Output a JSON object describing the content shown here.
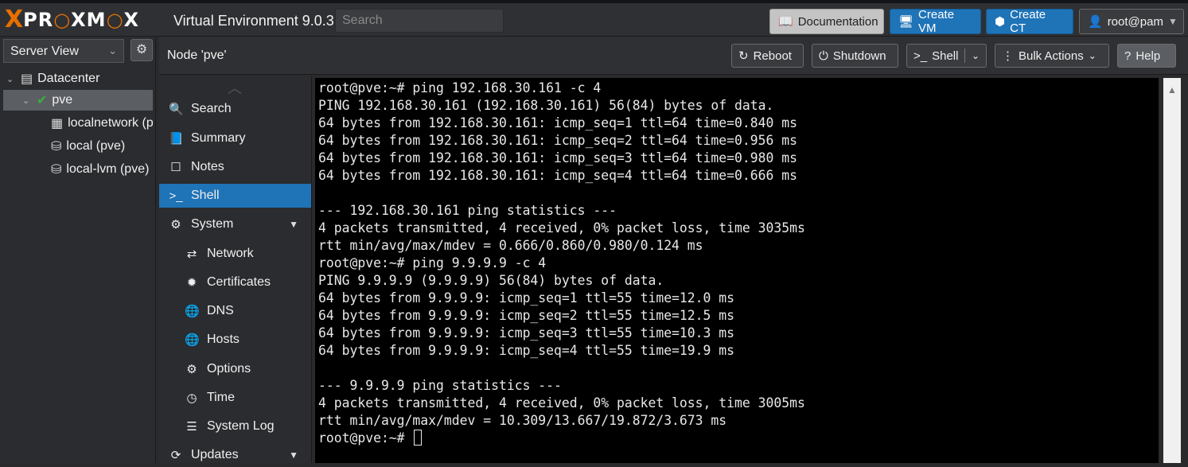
{
  "header": {
    "logo_x": "X",
    "logo_text_1": "PR",
    "logo_text_2": "XM",
    "logo_text_3": "X",
    "product": "Virtual Environment 9.0.3",
    "search_placeholder": "Search",
    "documentation": "Documentation",
    "create_vm": "Create VM",
    "create_ct": "Create CT",
    "user": "root@pam"
  },
  "sidebar": {
    "view": "Server View",
    "tree": [
      {
        "label": "Datacenter"
      },
      {
        "label": "pve"
      },
      {
        "label": "localnetwork (pve)"
      },
      {
        "label": "local (pve)"
      },
      {
        "label": "local-lvm (pve)"
      }
    ]
  },
  "node_header": {
    "title": "Node 'pve'",
    "reboot": "Reboot",
    "shutdown": "Shutdown",
    "shell": "Shell",
    "bulk": "Bulk Actions",
    "help": "Help"
  },
  "nav": {
    "items": [
      {
        "label": "Search",
        "icon": "search-icon"
      },
      {
        "label": "Summary",
        "icon": "book-icon"
      },
      {
        "label": "Notes",
        "icon": "note-icon"
      },
      {
        "label": "Shell",
        "icon": "terminal-icon"
      },
      {
        "label": "System",
        "icon": "cogs-icon"
      },
      {
        "label": "Network",
        "icon": "exchange-icon"
      },
      {
        "label": "Certificates",
        "icon": "certificate-icon"
      },
      {
        "label": "DNS",
        "icon": "globe-icon"
      },
      {
        "label": "Hosts",
        "icon": "globe-icon"
      },
      {
        "label": "Options",
        "icon": "gear-icon"
      },
      {
        "label": "Time",
        "icon": "clock-icon"
      },
      {
        "label": "System Log",
        "icon": "list-icon"
      },
      {
        "label": "Updates",
        "icon": "refresh-icon"
      }
    ]
  },
  "terminal": {
    "lines": [
      "root@pve:~# ping 192.168.30.161 -c 4",
      "PING 192.168.30.161 (192.168.30.161) 56(84) bytes of data.",
      "64 bytes from 192.168.30.161: icmp_seq=1 ttl=64 time=0.840 ms",
      "64 bytes from 192.168.30.161: icmp_seq=2 ttl=64 time=0.956 ms",
      "64 bytes from 192.168.30.161: icmp_seq=3 ttl=64 time=0.980 ms",
      "64 bytes from 192.168.30.161: icmp_seq=4 ttl=64 time=0.666 ms",
      "",
      "--- 192.168.30.161 ping statistics ---",
      "4 packets transmitted, 4 received, 0% packet loss, time 3035ms",
      "rtt min/avg/max/mdev = 0.666/0.860/0.980/0.124 ms",
      "root@pve:~# ping 9.9.9.9 -c 4",
      "PING 9.9.9.9 (9.9.9.9) 56(84) bytes of data.",
      "64 bytes from 9.9.9.9: icmp_seq=1 ttl=55 time=12.0 ms",
      "64 bytes from 9.9.9.9: icmp_seq=2 ttl=55 time=12.5 ms",
      "64 bytes from 9.9.9.9: icmp_seq=3 ttl=55 time=10.3 ms",
      "64 bytes from 9.9.9.9: icmp_seq=4 ttl=55 time=19.9 ms",
      "",
      "--- 9.9.9.9 ping statistics ---",
      "4 packets transmitted, 4 received, 0% packet loss, time 3005ms",
      "rtt min/avg/max/mdev = 10.309/13.667/19.872/3.673 ms"
    ],
    "prompt": "root@pve:~# "
  },
  "colors": {
    "accent": "#1f73b7",
    "logo_orange": "#e57000",
    "status_ok": "#3cb043"
  }
}
